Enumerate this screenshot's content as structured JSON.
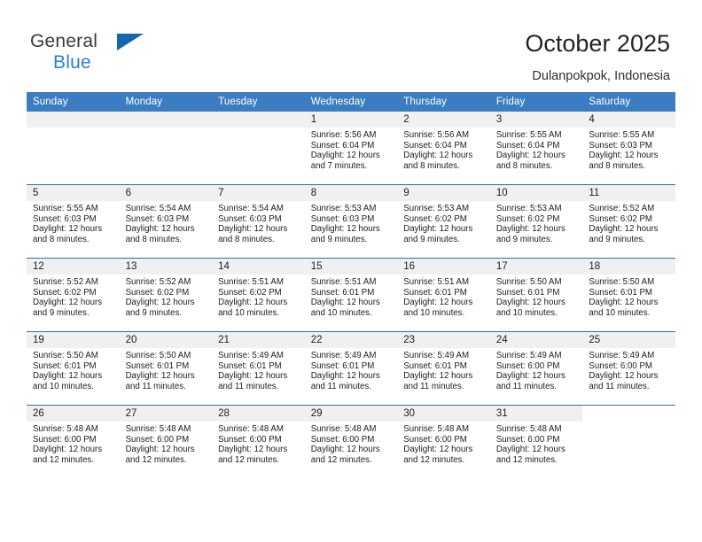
{
  "brand": {
    "line1": "General",
    "line2": "Blue",
    "accent_color": "#1565b0",
    "text_color": "#2a7fd4"
  },
  "header": {
    "title": "October 2025",
    "location": "Dulanpokpok, Indonesia"
  },
  "calendar": {
    "header_bg": "#3b7dc0",
    "daynum_bg": "#f0f0f0",
    "weekday_headers": [
      "Sunday",
      "Monday",
      "Tuesday",
      "Wednesday",
      "Thursday",
      "Friday",
      "Saturday"
    ],
    "weeks": [
      [
        {
          "day": "",
          "lines": []
        },
        {
          "day": "",
          "lines": []
        },
        {
          "day": "",
          "lines": []
        },
        {
          "day": "1",
          "lines": [
            "Sunrise: 5:56 AM",
            "Sunset: 6:04 PM",
            "Daylight: 12 hours and 7 minutes."
          ]
        },
        {
          "day": "2",
          "lines": [
            "Sunrise: 5:56 AM",
            "Sunset: 6:04 PM",
            "Daylight: 12 hours and 8 minutes."
          ]
        },
        {
          "day": "3",
          "lines": [
            "Sunrise: 5:55 AM",
            "Sunset: 6:04 PM",
            "Daylight: 12 hours and 8 minutes."
          ]
        },
        {
          "day": "4",
          "lines": [
            "Sunrise: 5:55 AM",
            "Sunset: 6:03 PM",
            "Daylight: 12 hours and 8 minutes."
          ]
        }
      ],
      [
        {
          "day": "5",
          "lines": [
            "Sunrise: 5:55 AM",
            "Sunset: 6:03 PM",
            "Daylight: 12 hours and 8 minutes."
          ]
        },
        {
          "day": "6",
          "lines": [
            "Sunrise: 5:54 AM",
            "Sunset: 6:03 PM",
            "Daylight: 12 hours and 8 minutes."
          ]
        },
        {
          "day": "7",
          "lines": [
            "Sunrise: 5:54 AM",
            "Sunset: 6:03 PM",
            "Daylight: 12 hours and 8 minutes."
          ]
        },
        {
          "day": "8",
          "lines": [
            "Sunrise: 5:53 AM",
            "Sunset: 6:03 PM",
            "Daylight: 12 hours and 9 minutes."
          ]
        },
        {
          "day": "9",
          "lines": [
            "Sunrise: 5:53 AM",
            "Sunset: 6:02 PM",
            "Daylight: 12 hours and 9 minutes."
          ]
        },
        {
          "day": "10",
          "lines": [
            "Sunrise: 5:53 AM",
            "Sunset: 6:02 PM",
            "Daylight: 12 hours and 9 minutes."
          ]
        },
        {
          "day": "11",
          "lines": [
            "Sunrise: 5:52 AM",
            "Sunset: 6:02 PM",
            "Daylight: 12 hours and 9 minutes."
          ]
        }
      ],
      [
        {
          "day": "12",
          "lines": [
            "Sunrise: 5:52 AM",
            "Sunset: 6:02 PM",
            "Daylight: 12 hours and 9 minutes."
          ]
        },
        {
          "day": "13",
          "lines": [
            "Sunrise: 5:52 AM",
            "Sunset: 6:02 PM",
            "Daylight: 12 hours and 9 minutes."
          ]
        },
        {
          "day": "14",
          "lines": [
            "Sunrise: 5:51 AM",
            "Sunset: 6:02 PM",
            "Daylight: 12 hours and 10 minutes."
          ]
        },
        {
          "day": "15",
          "lines": [
            "Sunrise: 5:51 AM",
            "Sunset: 6:01 PM",
            "Daylight: 12 hours and 10 minutes."
          ]
        },
        {
          "day": "16",
          "lines": [
            "Sunrise: 5:51 AM",
            "Sunset: 6:01 PM",
            "Daylight: 12 hours and 10 minutes."
          ]
        },
        {
          "day": "17",
          "lines": [
            "Sunrise: 5:50 AM",
            "Sunset: 6:01 PM",
            "Daylight: 12 hours and 10 minutes."
          ]
        },
        {
          "day": "18",
          "lines": [
            "Sunrise: 5:50 AM",
            "Sunset: 6:01 PM",
            "Daylight: 12 hours and 10 minutes."
          ]
        }
      ],
      [
        {
          "day": "19",
          "lines": [
            "Sunrise: 5:50 AM",
            "Sunset: 6:01 PM",
            "Daylight: 12 hours and 10 minutes."
          ]
        },
        {
          "day": "20",
          "lines": [
            "Sunrise: 5:50 AM",
            "Sunset: 6:01 PM",
            "Daylight: 12 hours and 11 minutes."
          ]
        },
        {
          "day": "21",
          "lines": [
            "Sunrise: 5:49 AM",
            "Sunset: 6:01 PM",
            "Daylight: 12 hours and 11 minutes."
          ]
        },
        {
          "day": "22",
          "lines": [
            "Sunrise: 5:49 AM",
            "Sunset: 6:01 PM",
            "Daylight: 12 hours and 11 minutes."
          ]
        },
        {
          "day": "23",
          "lines": [
            "Sunrise: 5:49 AM",
            "Sunset: 6:01 PM",
            "Daylight: 12 hours and 11 minutes."
          ]
        },
        {
          "day": "24",
          "lines": [
            "Sunrise: 5:49 AM",
            "Sunset: 6:00 PM",
            "Daylight: 12 hours and 11 minutes."
          ]
        },
        {
          "day": "25",
          "lines": [
            "Sunrise: 5:49 AM",
            "Sunset: 6:00 PM",
            "Daylight: 12 hours and 11 minutes."
          ]
        }
      ],
      [
        {
          "day": "26",
          "lines": [
            "Sunrise: 5:48 AM",
            "Sunset: 6:00 PM",
            "Daylight: 12 hours and 12 minutes."
          ]
        },
        {
          "day": "27",
          "lines": [
            "Sunrise: 5:48 AM",
            "Sunset: 6:00 PM",
            "Daylight: 12 hours and 12 minutes."
          ]
        },
        {
          "day": "28",
          "lines": [
            "Sunrise: 5:48 AM",
            "Sunset: 6:00 PM",
            "Daylight: 12 hours and 12 minutes."
          ]
        },
        {
          "day": "29",
          "lines": [
            "Sunrise: 5:48 AM",
            "Sunset: 6:00 PM",
            "Daylight: 12 hours and 12 minutes."
          ]
        },
        {
          "day": "30",
          "lines": [
            "Sunrise: 5:48 AM",
            "Sunset: 6:00 PM",
            "Daylight: 12 hours and 12 minutes."
          ]
        },
        {
          "day": "31",
          "lines": [
            "Sunrise: 5:48 AM",
            "Sunset: 6:00 PM",
            "Daylight: 12 hours and 12 minutes."
          ]
        },
        {
          "day": "",
          "lines": []
        }
      ]
    ]
  }
}
